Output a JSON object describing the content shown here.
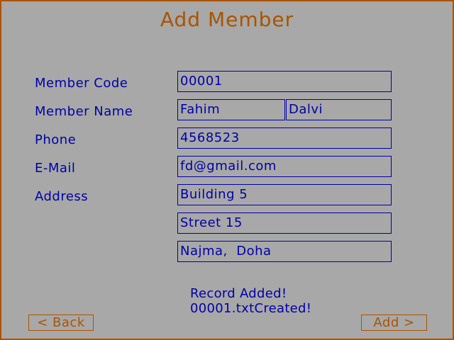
{
  "title": "Add Member",
  "labels": {
    "member_code": "Member Code",
    "member_name": "Member Name",
    "phone": "Phone",
    "email": "E-Mail",
    "address": "Address"
  },
  "fields": {
    "member_code": "00001",
    "first_name": "Fahim",
    "last_name": "Dalvi",
    "phone": "4568523",
    "email": "fd@gmail.com",
    "address_line1": "Building 5",
    "address_line2": "Street 15",
    "address_line3": "Najma,  Doha"
  },
  "status": {
    "line1": "Record Added!",
    "line2": "00001.txtCreated!"
  },
  "buttons": {
    "back": "< Back",
    "add": "Add >"
  },
  "colors": {
    "background": "#a8a8a8",
    "accent": "#a85400",
    "text": "#0000a8"
  }
}
